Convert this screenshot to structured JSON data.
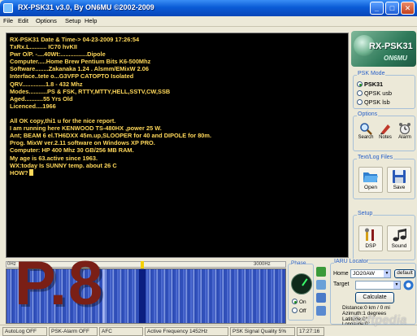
{
  "window": {
    "title": "RX-PSK31 v3.0, By ON6MU ©2002-2009",
    "min_label": "_",
    "max_label": "□",
    "close_label": "✕"
  },
  "menu": [
    "File",
    "Edit",
    "Options",
    "Setup",
    "Help"
  ],
  "log": {
    "lines": [
      "RX-PSK31 Date & Time-> 04-23-2009 17:26:54",
      "TxRx.L.......... IC70 hvKII",
      "Pwr O/P. -....40Wt:................Dipole",
      "Computer.....Home Brew Pentium Bits K6-500Mhz",
      "Software........Zakanaka 1.24 . Alsmm/EMixW 2.06",
      "Interface..tete o...G3VFP CATOPTO Isolated",
      "QRV..............1.8 - 432 Mhz",
      "Modes...........PS & FSK, RTTY,MTTY,HELL,SSTV,CW,SSB",
      "Aged...........55 Yrs Old",
      "Licenced....1966",
      "",
      "All OK copy,thi1 u for the nice report.",
      "I am running here KENWOOD TS-480HX ,power 25 W.",
      "Ant; BEAM 6 el.TH6DXX 45m.up,SLOOPER for 40 and DIPOLE for 80m.",
      "Prog. MixW ver.2.11 software on Windows XP PRO.",
      "Computer: HP 400 Mhz 30 GB/256 MB RAM.",
      "My age is 63.active since 1963.",
      "WX:today Is SUNNY temp. about  26 C",
      " HOW?"
    ]
  },
  "logo": {
    "name": "RX-PSK31",
    "sub": "ON6MU"
  },
  "psk_mode": {
    "title": "PSK Mode",
    "options": [
      {
        "label": "PSK31",
        "selected": true
      },
      {
        "label": "QPSK usb",
        "selected": false
      },
      {
        "label": "QPSK lsb",
        "selected": false
      }
    ]
  },
  "options_group": {
    "title": "Options",
    "tools": [
      {
        "label": "Search",
        "icon": "magnifier-icon"
      },
      {
        "label": "Notes",
        "icon": "notes-icon"
      },
      {
        "label": "Alarm",
        "icon": "alarm-icon"
      }
    ]
  },
  "text_log_files": {
    "title": "Text/Log Files",
    "open_label": "Open",
    "save_label": "Save"
  },
  "setup_group": {
    "title": "Setup",
    "dsp_label": "DSP",
    "sound_label": "Sound"
  },
  "waterfall": {
    "low_label": "0Hz",
    "high_label": "3000Hz"
  },
  "overlay": {
    "text": "P.8"
  },
  "phase": {
    "title": "Phase",
    "on_label": "On",
    "off_label": "Off",
    "on_selected": true
  },
  "iaru": {
    "title": "IARU Locator",
    "home_label": "Home",
    "home_value": "JO20AW",
    "default_label": "default",
    "target_label": "Target",
    "target_value": "",
    "calculate_label": "Calculate",
    "distance": "Distance:0 km / 0 mi",
    "azimuth": "Azimuth:1 degrees",
    "latitude": "Latitude:0°",
    "longitude": "Longitude:0°"
  },
  "status": {
    "autolog": "AutoLog OFF",
    "psk_alarm": "PSK-Alarm OFF",
    "afc": "AFC",
    "active_frequency": "Active Frequency 1452Hz",
    "signal_quality": "PSK Signal Quality 5%",
    "time": "17:27:16"
  },
  "watermark": "Softpedia",
  "colors": {
    "log_text": "#ffd85a",
    "log_bg": "#000000",
    "accent": "#2860c8",
    "overlay": "#7a1f16"
  }
}
